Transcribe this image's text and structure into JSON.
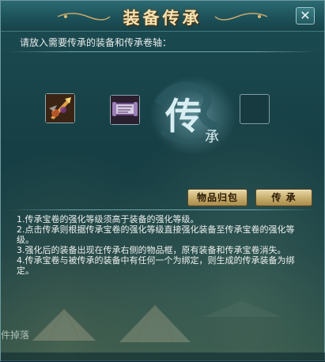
{
  "window": {
    "title": "装备传承",
    "close_glyph": "✕"
  },
  "instruction": "请放入需要传承的装备和传承卷轴：",
  "slots": [
    {
      "name": "equipment-slot",
      "icon": "weapon-icon"
    },
    {
      "name": "scroll-slot",
      "icon": "scroll-icon"
    },
    {
      "name": "result-slot",
      "icon": ""
    }
  ],
  "emblem": {
    "main": "传",
    "sub": "承"
  },
  "buttons": {
    "return_label": "物品归包",
    "inherit_label": "传 承"
  },
  "rules": [
    "1.传承宝卷的强化等级须高于装备的强化等级。",
    "2.点击传承则根据传承宝卷的强化等级直接强化装备至传承宝卷的强化等级。",
    "3.强化后的装备出现在传承右侧的物品框，原有装备和传承宝卷消失。",
    "4.传承宝卷与被传承的装备中有任何一个为绑定，则生成的传承装备为绑定。"
  ],
  "background_text": "件掉落",
  "colors": {
    "title": "#f3e3b4",
    "button": "#c6ad6d",
    "panel": "#173e43"
  }
}
